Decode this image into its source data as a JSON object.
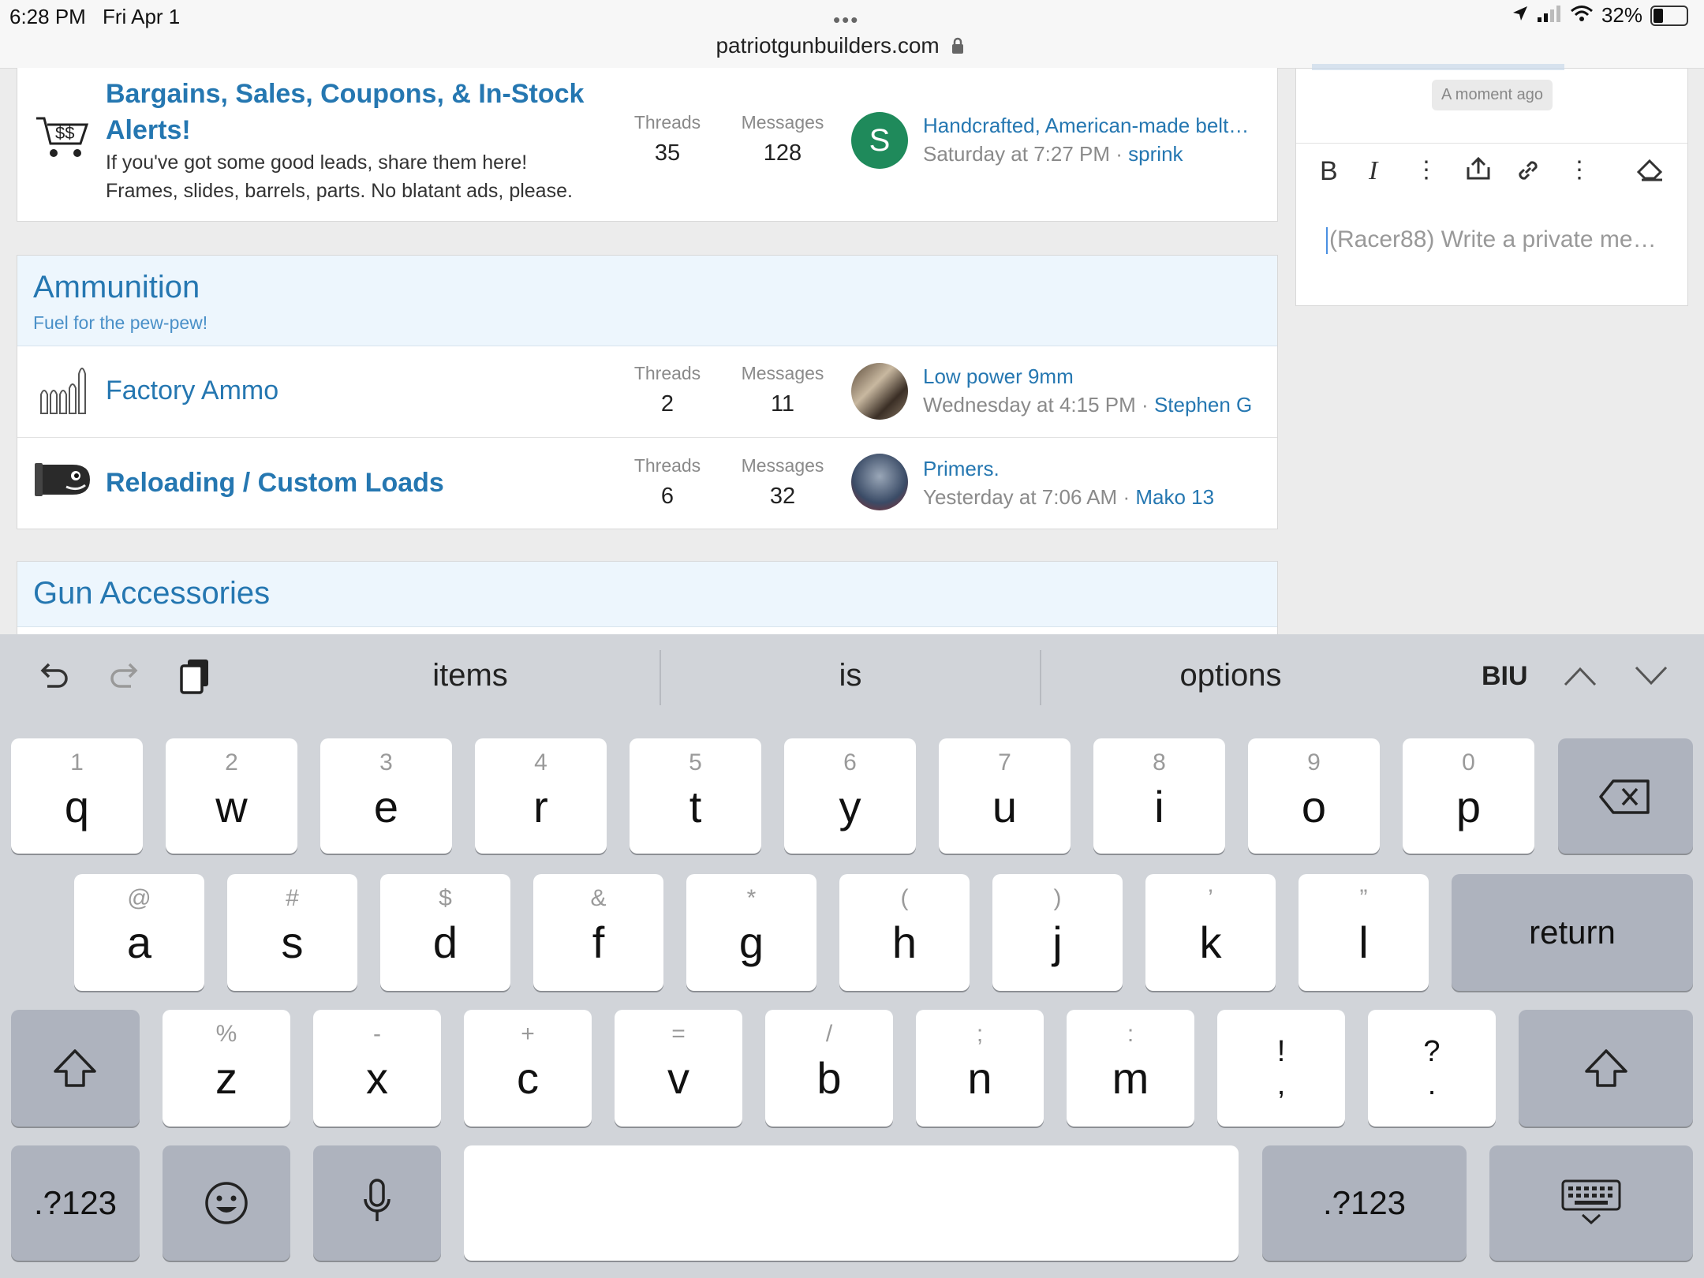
{
  "status": {
    "time": "6:28 PM",
    "date": "Fri Apr 1",
    "url": "patriotgunbuilders.com",
    "battery": "32%"
  },
  "forum1": {
    "title_line1": "Bargains, Sales, Coupons, & In-Stock",
    "title_line2": "Alerts!",
    "desc_line1": "If you've got some good leads, share them here!",
    "desc_line2": "Frames, slides, barrels, parts. No blatant ads, please.",
    "threads_label": "Threads",
    "threads": "35",
    "messages_label": "Messages",
    "messages": "128",
    "avatar_letter": "S",
    "last_title": "Handcrafted, American-made belt…",
    "last_time": "Saturday at 7:27 PM",
    "sep": "·",
    "last_user": "sprink"
  },
  "ammo": {
    "title": "Ammunition",
    "desc": "Fuel for the pew-pew!",
    "forums": [
      {
        "title": "Factory Ammo",
        "threads_label": "Threads",
        "threads": "2",
        "messages_label": "Messages",
        "messages": "11",
        "last_title": "Low power 9mm",
        "last_time": "Wednesday at 4:15 PM",
        "sep": "·",
        "last_user": "Stephen G"
      },
      {
        "title": "Reloading / Custom Loads",
        "threads_label": "Threads",
        "threads": "6",
        "messages_label": "Messages",
        "messages": "32",
        "last_title": "Primers.",
        "last_time": "Yesterday at 7:06 AM",
        "sep": "·",
        "last_user": "Mako 13"
      }
    ]
  },
  "gun_acc": {
    "title": "Gun Accessories"
  },
  "side": {
    "timestamp": "A moment ago",
    "placeholder": "(Racer88) Write a private me…",
    "bold": "B",
    "italic": "I"
  },
  "keyboard": {
    "suggestions": [
      "items",
      "is",
      "options"
    ],
    "biu": "BIU",
    "row1": [
      {
        "hint": "1",
        "key": "q"
      },
      {
        "hint": "2",
        "key": "w"
      },
      {
        "hint": "3",
        "key": "e"
      },
      {
        "hint": "4",
        "key": "r"
      },
      {
        "hint": "5",
        "key": "t"
      },
      {
        "hint": "6",
        "key": "y"
      },
      {
        "hint": "7",
        "key": "u"
      },
      {
        "hint": "8",
        "key": "i"
      },
      {
        "hint": "9",
        "key": "o"
      },
      {
        "hint": "0",
        "key": "p"
      }
    ],
    "row2": [
      {
        "hint": "@",
        "key": "a"
      },
      {
        "hint": "#",
        "key": "s"
      },
      {
        "hint": "$",
        "key": "d"
      },
      {
        "hint": "&",
        "key": "f"
      },
      {
        "hint": "*",
        "key": "g"
      },
      {
        "hint": "(",
        "key": "h"
      },
      {
        "hint": ")",
        "key": "j"
      },
      {
        "hint": "’",
        "key": "k"
      },
      {
        "hint": "”",
        "key": "l"
      }
    ],
    "return": "return",
    "row3": [
      {
        "hint": "%",
        "key": "z"
      },
      {
        "hint": "-",
        "key": "x"
      },
      {
        "hint": "+",
        "key": "c"
      },
      {
        "hint": "=",
        "key": "v"
      },
      {
        "hint": "/",
        "key": "b"
      },
      {
        "hint": ";",
        "key": "n"
      },
      {
        "hint": ":",
        "key": "m"
      }
    ],
    "punct1": {
      "top": "!",
      "bottom": ","
    },
    "punct2": {
      "top": "?",
      "bottom": "."
    },
    "numkey": ".?123"
  }
}
